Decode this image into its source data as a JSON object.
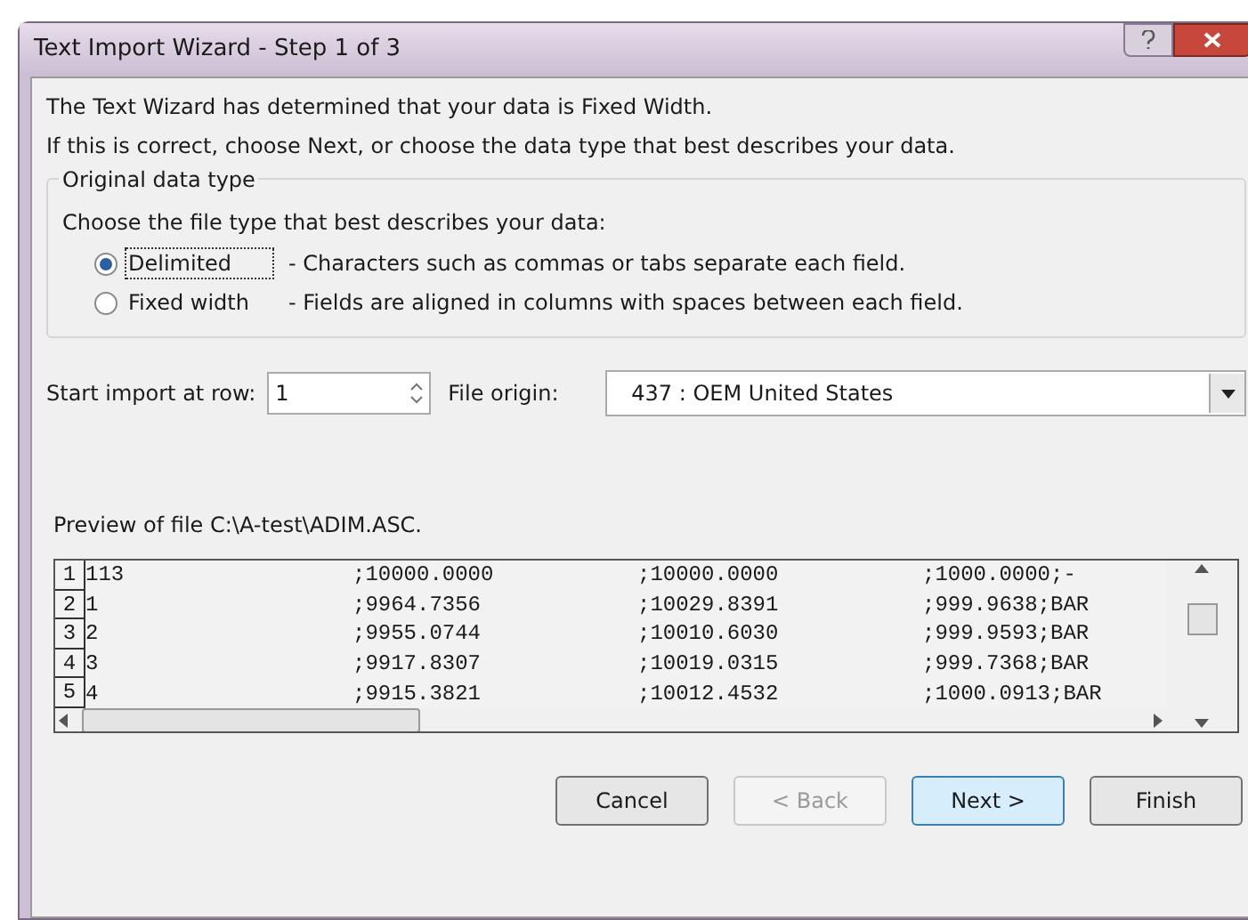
{
  "window": {
    "title": "Text Import Wizard - Step 1 of 3"
  },
  "intro": [
    "The Text Wizard has determined that your data is Fixed Width.",
    "If this is correct, choose Next, or choose the data type that best describes your data."
  ],
  "group": {
    "title": "Original data type",
    "prompt": "Choose the file type that best describes your data:",
    "options": [
      {
        "label": "Delimited",
        "description": "- Characters such as commas or tabs separate each field.",
        "selected": true
      },
      {
        "label": "Fixed width",
        "description": "- Fields are aligned in columns with spaces between each field.",
        "selected": false
      }
    ]
  },
  "start_row": {
    "label": "Start import at row:",
    "value": "1"
  },
  "file_origin": {
    "label": "File origin:",
    "value": "437 : OEM United States"
  },
  "preview": {
    "title": "Preview of file C:\\A-test\\ADIM.ASC.",
    "rows": [
      {
        "number": "1",
        "cells": [
          "113",
          ";10000.0000",
          ";10000.0000",
          ";1000.0000;-"
        ]
      },
      {
        "number": "2",
        "cells": [
          "1",
          ";9964.7356",
          ";10029.8391",
          ";999.9638;BAR"
        ]
      },
      {
        "number": "3",
        "cells": [
          "2",
          ";9955.0744",
          ";10010.6030",
          ";999.9593;BAR"
        ]
      },
      {
        "number": "4",
        "cells": [
          "3",
          ";9917.8307",
          ";10019.0315",
          ";999.7368;BAR"
        ]
      },
      {
        "number": "5",
        "cells": [
          "4",
          ";9915.3821",
          ";10012.4532",
          ";1000.0913;BAR"
        ]
      }
    ]
  },
  "buttons": [
    {
      "label": "Cancel",
      "disabled": false,
      "default": false
    },
    {
      "label": "< Back",
      "disabled": true,
      "default": false
    },
    {
      "label": "Next >",
      "disabled": false,
      "default": true
    },
    {
      "label": "Finish",
      "disabled": false,
      "default": false
    }
  ]
}
